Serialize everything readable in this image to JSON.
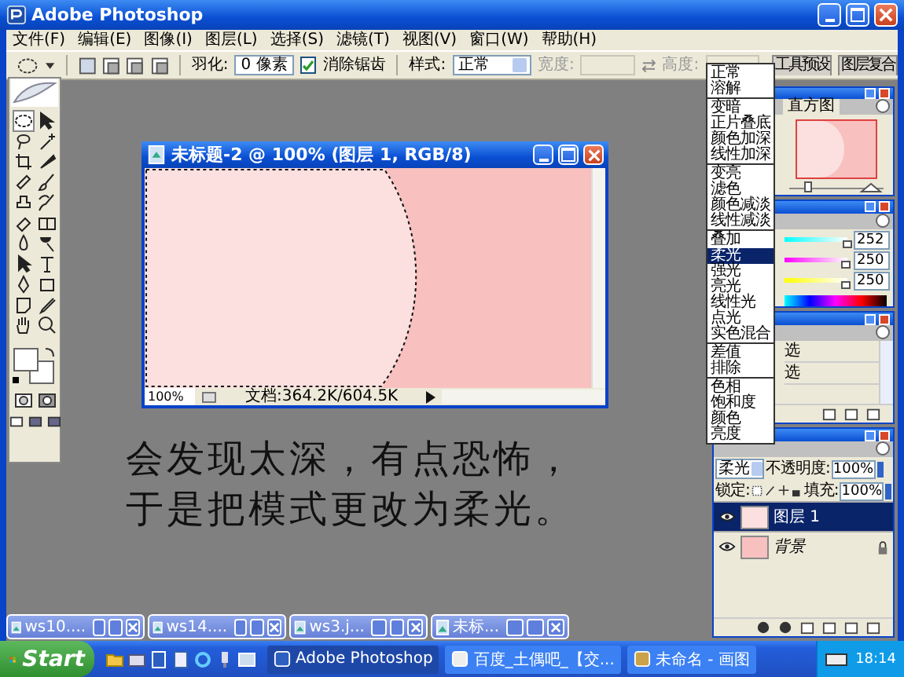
{
  "window": {
    "title": "Adobe Photoshop"
  },
  "menu": [
    "文件(F)",
    "编辑(E)",
    "图像(I)",
    "图层(L)",
    "选择(S)",
    "滤镜(T)",
    "视图(V)",
    "窗口(W)",
    "帮助(H)"
  ],
  "options_bar": {
    "feather": {
      "label": "羽化:",
      "value": "0 像素"
    },
    "antialias": {
      "label": "消除锯齿",
      "checked": true
    },
    "style": {
      "label": "样式:",
      "value": "正常"
    },
    "width": {
      "label": "宽度:",
      "disabled": true
    },
    "height": {
      "label": "高度:",
      "disabled": true
    }
  },
  "palette_well": [
    "工具预设",
    "图层复合"
  ],
  "document": {
    "title": "未标题-2 @ 100% (图层 1, RGB/8)",
    "zoom": "100%",
    "info": "文档:364.2K/604.5K"
  },
  "caption": [
    "会发现太深，有点恐怖，",
    "于是把模式更改为柔光。"
  ],
  "blend_menu": [
    [
      {
        "label": "正常",
        "selected": false
      },
      {
        "label": "溶解",
        "selected": false
      }
    ],
    [
      {
        "label": "变暗",
        "selected": false
      },
      {
        "label": "正片叠底",
        "selected": false
      },
      {
        "label": "颜色加深",
        "selected": false
      },
      {
        "label": "线性加深",
        "selected": false
      }
    ],
    [
      {
        "label": "变亮",
        "selected": false
      },
      {
        "label": "滤色",
        "selected": false
      },
      {
        "label": "颜色减淡",
        "selected": false
      },
      {
        "label": "线性减淡",
        "selected": false
      }
    ],
    [
      {
        "label": "叠加",
        "selected": false
      },
      {
        "label": "柔光",
        "selected": true
      },
      {
        "label": "强光",
        "selected": false
      },
      {
        "label": "亮光",
        "selected": false
      },
      {
        "label": "线性光",
        "selected": false
      },
      {
        "label": "点光",
        "selected": false
      },
      {
        "label": "实色混合",
        "selected": false
      }
    ],
    [
      {
        "label": "差值",
        "selected": false
      },
      {
        "label": "排除",
        "selected": false
      }
    ],
    [
      {
        "label": "色相",
        "selected": false
      },
      {
        "label": "饱和度",
        "selected": false
      },
      {
        "label": "颜色",
        "selected": false
      },
      {
        "label": "亮度",
        "selected": false
      }
    ]
  ],
  "navigator": {
    "tab": "直方图"
  },
  "color": {
    "channels": [
      {
        "value": "252",
        "level": 0.99
      },
      {
        "value": "250",
        "level": 0.98
      },
      {
        "value": "250",
        "level": 0.98
      }
    ]
  },
  "history": {
    "items": [
      "选",
      "选"
    ]
  },
  "layers": {
    "blend": "柔光",
    "opacity_label": "不透明度:",
    "opacity": "100%",
    "lock_label": "锁定:",
    "fill_label": "填充:",
    "fill": "100%",
    "items": [
      {
        "name": "图层 1",
        "selected": true,
        "locked": false
      },
      {
        "name": "背景",
        "selected": false,
        "locked": true
      }
    ]
  },
  "minimized": [
    "ws10....",
    "ws14....",
    "ws3.j...",
    "未标..."
  ],
  "taskbar": {
    "start": "Start",
    "tasks": [
      {
        "label": "Adobe Photoshop",
        "selected": true
      },
      {
        "label": "百度_土偶吧_【交...",
        "selected": false
      },
      {
        "label": "未命名 - 画图",
        "selected": false
      }
    ],
    "clock": "18:14"
  }
}
